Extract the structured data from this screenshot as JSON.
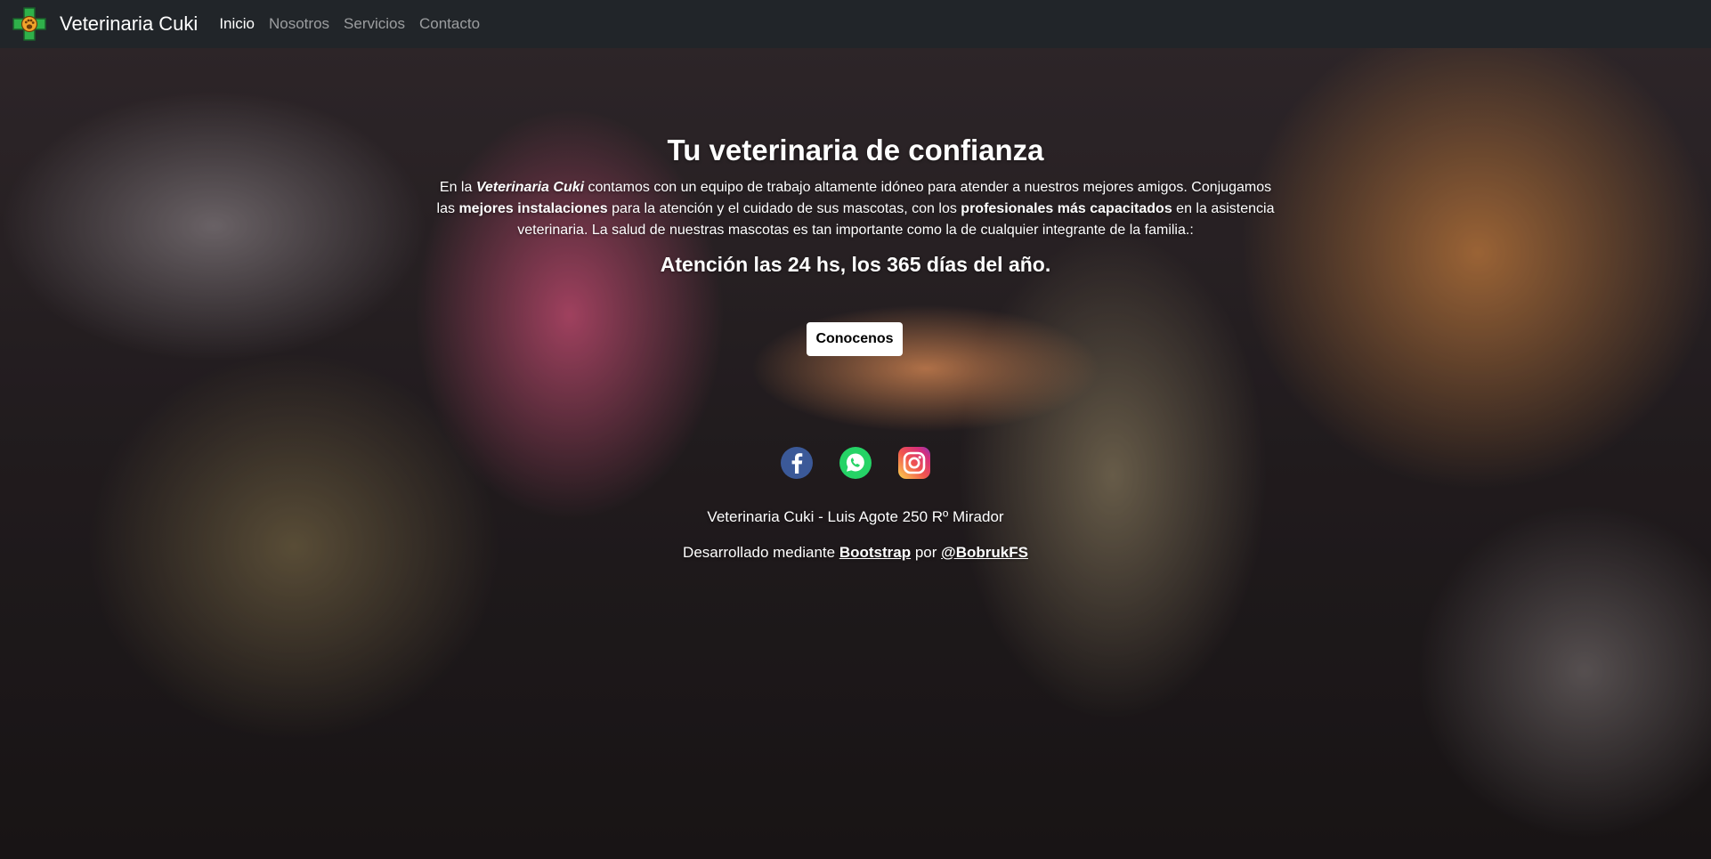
{
  "navbar": {
    "brand_name": "Veterinaria Cuki",
    "links": [
      {
        "label": "Inicio",
        "active": true
      },
      {
        "label": "Nosotros",
        "active": false
      },
      {
        "label": "Servicios",
        "active": false
      },
      {
        "label": "Contacto",
        "active": false
      }
    ]
  },
  "hero": {
    "title": "Tu veterinaria de confianza",
    "paragraph": {
      "p1": "En la ",
      "brand_emphasis": "Veterinaria Cuki",
      "p2": " contamos con un equipo de trabajo altamente idóneo para atender a nuestros mejores amigos. Conjugamos las ",
      "bold1": "mejores instalaciones",
      "p3": " para la atención y el cuidado de sus mascotas, con los ",
      "bold2": "profesionales más capacitados",
      "p4": " en la asistencia veterinaria. La salud de nuestras mascotas es tan importante como la de cualquier integrante de la familia.:"
    },
    "hours": "Atención las 24 hs, los 365 días del año.",
    "cta_label": "Conocenos"
  },
  "socials": [
    {
      "icon": "facebook-icon",
      "color": "#3b5998"
    },
    {
      "icon": "whatsapp-icon",
      "color": "#25d366"
    },
    {
      "icon": "instagram-icon",
      "color": "#e1306c"
    }
  ],
  "footer": {
    "address": "Veterinaria Cuki - Luis Agote 250 Rº Mirador",
    "credit_prefix": "Desarrollado mediante ",
    "credit_link1": "Bootstrap",
    "credit_middle": " por ",
    "credit_link2": "@BobrukFS"
  },
  "colors": {
    "navbar_bg": "#212529",
    "logo_cross": "#2fb14a",
    "logo_paw": "#f2a32b"
  }
}
